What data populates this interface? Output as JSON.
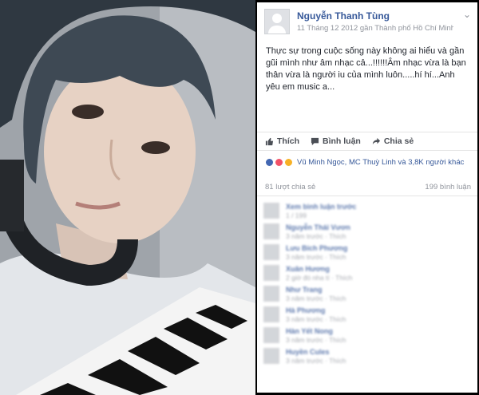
{
  "post": {
    "author": "Nguyễn Thanh Tùng",
    "meta": "11 Tháng 12 2012 gần Thành phố Hồ Chí Minh · ",
    "text": "Thực sự trong cuộc sống này không ai hiểu và gần gũi mình như âm nhạc cả...!!!!!!Âm nhạc vừa là bạn thân vừa là người iu của mình luôn.....hí hí...Anh yêu em music a..."
  },
  "actions": {
    "like": "Thích",
    "comment": "Bình luận",
    "share": "Chia sẻ"
  },
  "reactions": {
    "text": "Vũ Minh Ngọc, MC Thuỳ Linh và 3,8K người khác"
  },
  "counts": {
    "shares": "81 lượt chia sẻ",
    "comments": "199 bình luận"
  },
  "comments": [
    {
      "name": "Xem bình luận trước",
      "detail": "1 / 199"
    },
    {
      "name": "Nguyễn Thái Vươn",
      "detail": "3 năm trước · Thích"
    },
    {
      "name": "Lưu Bích Phương",
      "detail": "3 năm trước · Thích"
    },
    {
      "name": "Xuân Hương",
      "detail": "2 giờ đó nha tí · Thích"
    },
    {
      "name": "Như Trang",
      "detail": "3 năm trước · Thích"
    },
    {
      "name": "Hà Phương",
      "detail": "3 năm trước · Thích"
    },
    {
      "name": "Hàn Yết Nong",
      "detail": "3 năm trước · Thích"
    },
    {
      "name": "Huyền Cules",
      "detail": "3 năm trước · Thích"
    }
  ],
  "colors": {
    "link": "#365899",
    "muted": "#90949c",
    "like_reaction": "#4267b2"
  }
}
